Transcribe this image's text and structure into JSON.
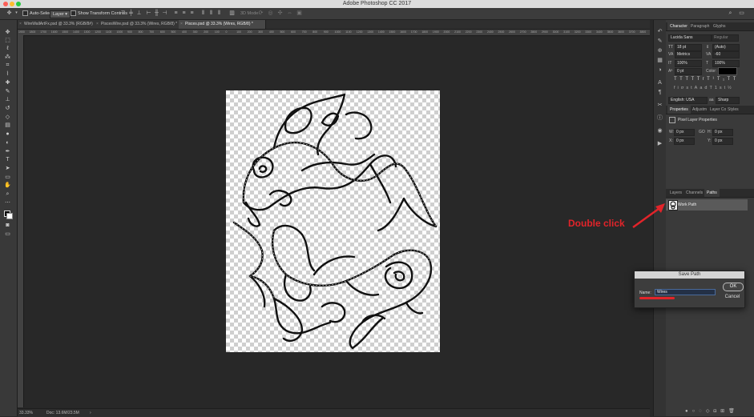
{
  "app": {
    "title": "Adobe Photoshop CC 2017"
  },
  "options_bar": {
    "auto_select_label": "Auto-Select:",
    "auto_select_value": "Layer",
    "show_transform_label": "Show Transform Controls",
    "mode_3d_label": "3D Mode:"
  },
  "tabs": [
    {
      "label": "WireWallArtFx.psd @ 33.3% (RGB/8#)"
    },
    {
      "label": "PiscesWire.psd @ 33.3% (Wires, RGB/8) *"
    },
    {
      "label": "Pisces.psd @ 33.3% (Wires, RGB/8) *"
    }
  ],
  "ruler_labels": [
    "1900",
    "1800",
    "1700",
    "1600",
    "1500",
    "1400",
    "1300",
    "1200",
    "1100",
    "1000",
    "900",
    "800",
    "700",
    "600",
    "500",
    "400",
    "300",
    "200",
    "100",
    "0",
    "100",
    "200",
    "300",
    "400",
    "500",
    "600",
    "700",
    "800",
    "900",
    "1000",
    "1100",
    "1200",
    "1300",
    "1400",
    "1500",
    "1600",
    "1700",
    "1800",
    "1900",
    "2000",
    "2100",
    "2200",
    "2300",
    "2400",
    "2500",
    "2600",
    "2700",
    "2800",
    "2900",
    "3000",
    "3100",
    "3200",
    "3300",
    "3400",
    "3500",
    "3600",
    "3700",
    "3800"
  ],
  "status": {
    "zoom": "33.33%",
    "doc": "Doc: 13.6M/23.5M"
  },
  "character_panel": {
    "tabs": [
      "Character",
      "Paragraph",
      "Glyphs"
    ],
    "font_family": "Lucida Sans",
    "font_style": "Regular",
    "font_size": "18 pt",
    "leading": "(Auto)",
    "kerning": "Metrics",
    "tracking": "-60",
    "vertical_scale": "100%",
    "horizontal_scale": "100%",
    "baseline": "0 pt",
    "color_label": "Color:",
    "style_buttons": [
      "T",
      "T",
      "TT",
      "Tr",
      "T¹",
      "T₁",
      "T",
      "T"
    ],
    "opentype_buttons": [
      "fi",
      "ơ",
      "st",
      "A",
      "ad",
      "T",
      "1st",
      "½"
    ],
    "language": "English: USA",
    "antialias": "Sharp"
  },
  "properties_panel": {
    "tabs": [
      "Properties",
      "Adjustm",
      "Layer Co",
      "Styles"
    ],
    "title": "Pixel Layer Properties",
    "w_label": "W:",
    "w_value": "0 px",
    "h_label": "H:",
    "h_value": "0 px",
    "x_label": "X:",
    "x_value": "0 px",
    "y_label": "Y:",
    "y_value": "0 px",
    "link": "GO"
  },
  "layers_panel": {
    "tabs": [
      "Layers",
      "Channels",
      "Paths"
    ],
    "path_name": "Work Path"
  },
  "annotation": {
    "text": "Double click",
    "color": "#e2242a"
  },
  "save_path_dialog": {
    "title": "Save Path",
    "name_label": "Name:",
    "name_value": "Wires",
    "ok_label": "OK",
    "cancel_label": "Cancel"
  },
  "colors": {
    "accent_red": "#e2242a",
    "ui_dark": "#282828",
    "panel": "#3a3a3a"
  }
}
